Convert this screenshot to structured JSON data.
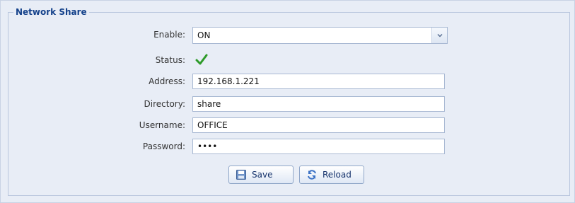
{
  "fieldset": {
    "legend": "Network Share"
  },
  "form": {
    "enable": {
      "label": "Enable:",
      "value": "ON"
    },
    "status": {
      "label": "Status:",
      "icon": "check-icon",
      "color": "#2e9b2a"
    },
    "address": {
      "label": "Address:",
      "value": "192.168.1.221"
    },
    "directory": {
      "label": "Directory:",
      "value": "share"
    },
    "username": {
      "label": "Username:",
      "value": "OFFICE"
    },
    "password": {
      "label": "Password:",
      "value": "••••"
    }
  },
  "buttons": {
    "save": {
      "label": "Save",
      "icon": "floppy-disk-icon"
    },
    "reload": {
      "label": "Reload",
      "icon": "refresh-icon"
    }
  },
  "colors": {
    "panel_bg": "#e8edf6",
    "legend_text": "#15428b",
    "border": "#a9b9d3"
  }
}
